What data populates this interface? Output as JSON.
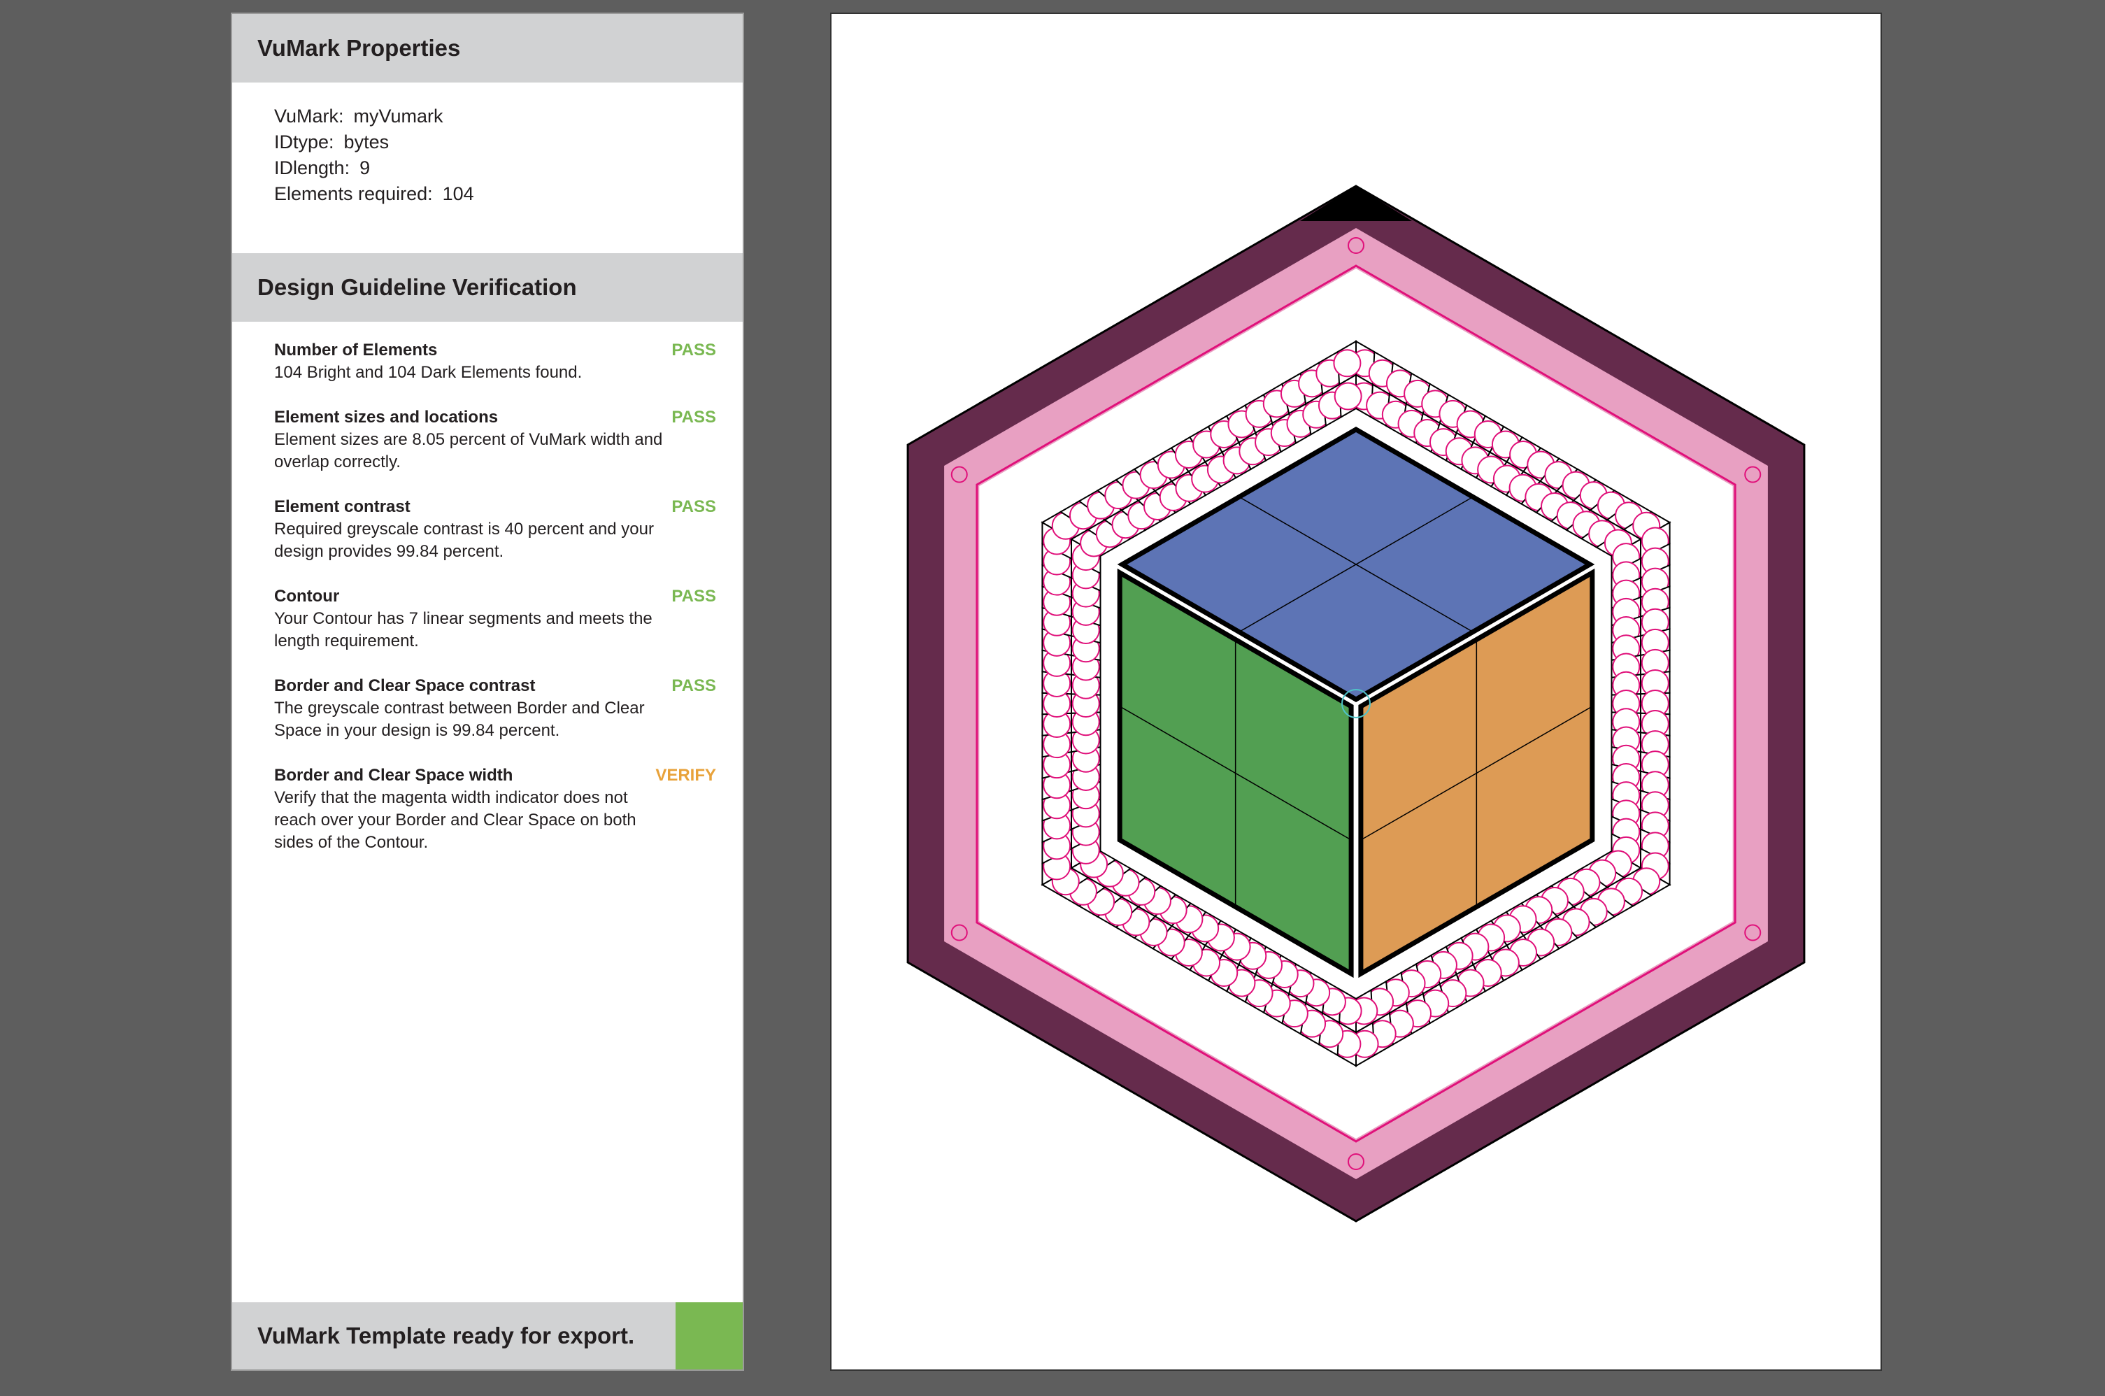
{
  "properties": {
    "title": "VuMark Properties",
    "rows": [
      {
        "key": "VuMark:",
        "value": "myVumark"
      },
      {
        "key": "IDtype:",
        "value": "bytes"
      },
      {
        "key": "IDlength:",
        "value": "9"
      },
      {
        "key": "Elements required:",
        "value": "104"
      }
    ]
  },
  "verification": {
    "title": "Design Guideline Verification",
    "checks": [
      {
        "title": "Number of Elements",
        "status": "PASS",
        "description": "104 Bright and 104 Dark Elements found."
      },
      {
        "title": "Element sizes and locations",
        "status": "PASS",
        "description": "Element sizes are 8.05 percent of VuMark width and overlap correctly."
      },
      {
        "title": "Element contrast",
        "status": "PASS",
        "description": "Required greyscale contrast is 40 percent and your design provides 99.84 percent."
      },
      {
        "title": "Contour",
        "status": "PASS",
        "description": "Your Contour has 7 linear segments and meets the length requirement."
      },
      {
        "title": "Border and Clear Space contrast",
        "status": "PASS",
        "description": "The greyscale contrast between Border and Clear Space in your design is 99.84 percent."
      },
      {
        "title": "Border and Clear Space width",
        "status": "VERIFY",
        "description": "Verify that the magenta width indicator does not reach over your Border and Clear Space on both sides of the Contour."
      }
    ]
  },
  "footer": {
    "text": "VuMark Template ready for export.",
    "indicator_color": "#7ab852"
  },
  "colors": {
    "pass": "#7ab852",
    "verify": "#e8a23a",
    "border_dark": "#652b4c",
    "border_pink": "#e8a0c2",
    "magenta": "#e0107a",
    "face_top": "#5d74b5",
    "face_left": "#529f52",
    "face_right": "#dd9b55"
  },
  "icons": {
    "footer_status": "status-ok-swatch"
  }
}
